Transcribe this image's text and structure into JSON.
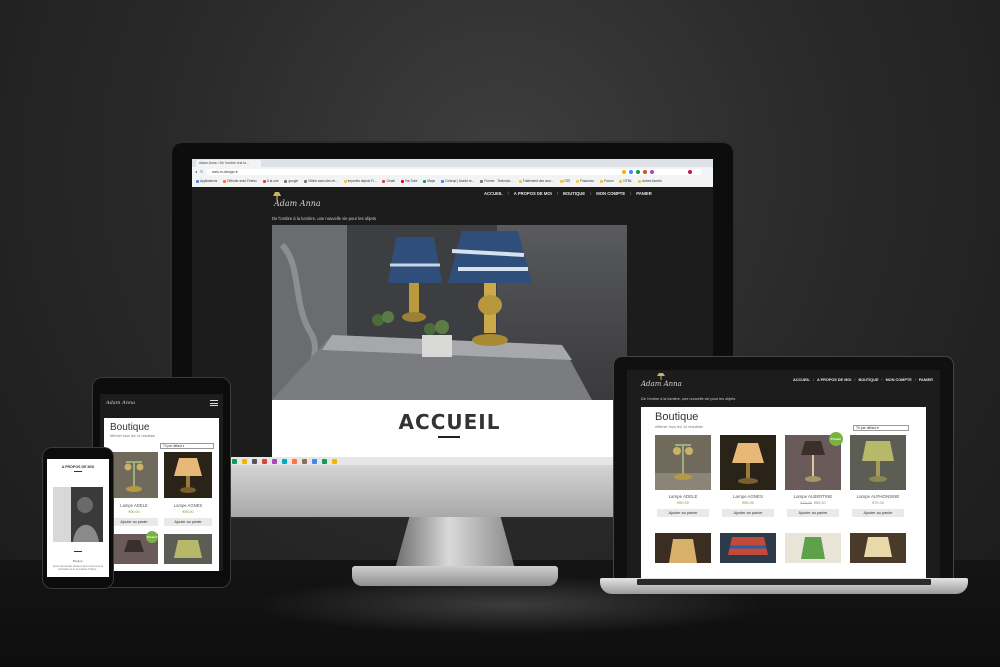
{
  "browser": {
    "tab_title": "Adam Anna • De l'ombre à la lu...",
    "url": "web-m-design.fr",
    "bookmarks": [
      "Applications",
      "Débuter avec Firefox",
      "À la une",
      "google",
      "Vitrine avec des mi...",
      "Importés depuis Fi...",
      "Gmail",
      "YouTube",
      "Maps",
      "Codeup | Useful re...",
      "Former - Technolo...",
      "Traitement des cour...",
      "CSS",
      "Financeur",
      "Forum",
      "HTML",
      "Autres favoris"
    ]
  },
  "site": {
    "logo": "Adam Anna",
    "tagline": "De l'ombre à la lumière, une nouvelle vie pour les objets",
    "nav": [
      "ACCUEIL",
      "A PROPOS DE MOI",
      "BOUTIQUE",
      "MON COMPTE",
      "PANIER"
    ],
    "nav_separator": "/",
    "hero_title": "ACCUEIL"
  },
  "shop": {
    "title": "Boutique",
    "result_count": "Afficher tous les 14 résultats",
    "sort_selected": "Tri par défaut",
    "add_to_cart": "Ajouter au panier",
    "promo_badge": "Promo!",
    "products": [
      {
        "name": "Lampe ADELE",
        "price": "€90,00",
        "old_price": ""
      },
      {
        "name": "Lampe AGNES",
        "price": "€95,00",
        "old_price": ""
      },
      {
        "name": "Lampe ALBERTINE",
        "price": "€65,00",
        "old_price": "€75,00"
      },
      {
        "name": "Lampe ALPHONSINE",
        "price": "€70,00",
        "old_price": ""
      }
    ]
  },
  "phone": {
    "section_title": "A PROPOS DE MOI",
    "caption": "Bonjour,",
    "body_text": "Après des années passées dans l'univers de la décoration et de la création d'objets..."
  },
  "tablet": {
    "menu_icon": "hamburger-icon"
  },
  "colors": {
    "site_background": "#1c1c1c",
    "price_green": "#7a9a3a",
    "promo_green": "#7ab342",
    "accent_gold": "#c9b36a"
  }
}
